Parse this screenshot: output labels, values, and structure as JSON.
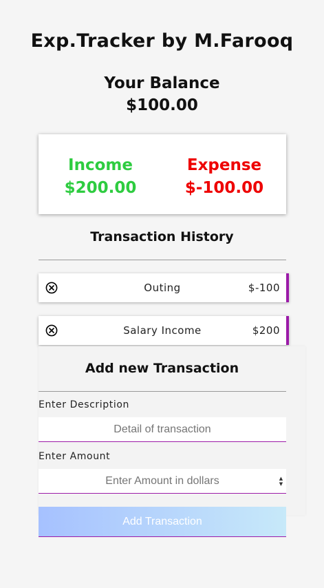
{
  "header": {
    "title": "Exp.Tracker by M.Farooq"
  },
  "balance": {
    "label": "Your Balance",
    "value": "$100.00"
  },
  "summary": {
    "income_label": "Income",
    "income_value": "$200.00",
    "expense_label": "Expense",
    "expense_value": "$-100.00"
  },
  "history": {
    "title": "Transaction History",
    "items": [
      {
        "description": "Outing",
        "amount": "$-100",
        "delete_icon": "circle-x-icon"
      },
      {
        "description": "Salary Income",
        "amount": "$200",
        "delete_icon": "circle-x-icon"
      }
    ]
  },
  "form": {
    "title": "Add new Transaction",
    "description_label": "Enter Description",
    "description_placeholder": "Detail of transaction",
    "amount_label": "Enter Amount",
    "amount_placeholder": "Enter Amount in dollars",
    "submit_label": "Add Transaction"
  },
  "colors": {
    "income": "#2ecc40",
    "expense": "#ee0000",
    "accent": "#9b1aa8",
    "button_gradient_start": "#a6c1ff",
    "button_gradient_end": "#c7e9f9"
  }
}
